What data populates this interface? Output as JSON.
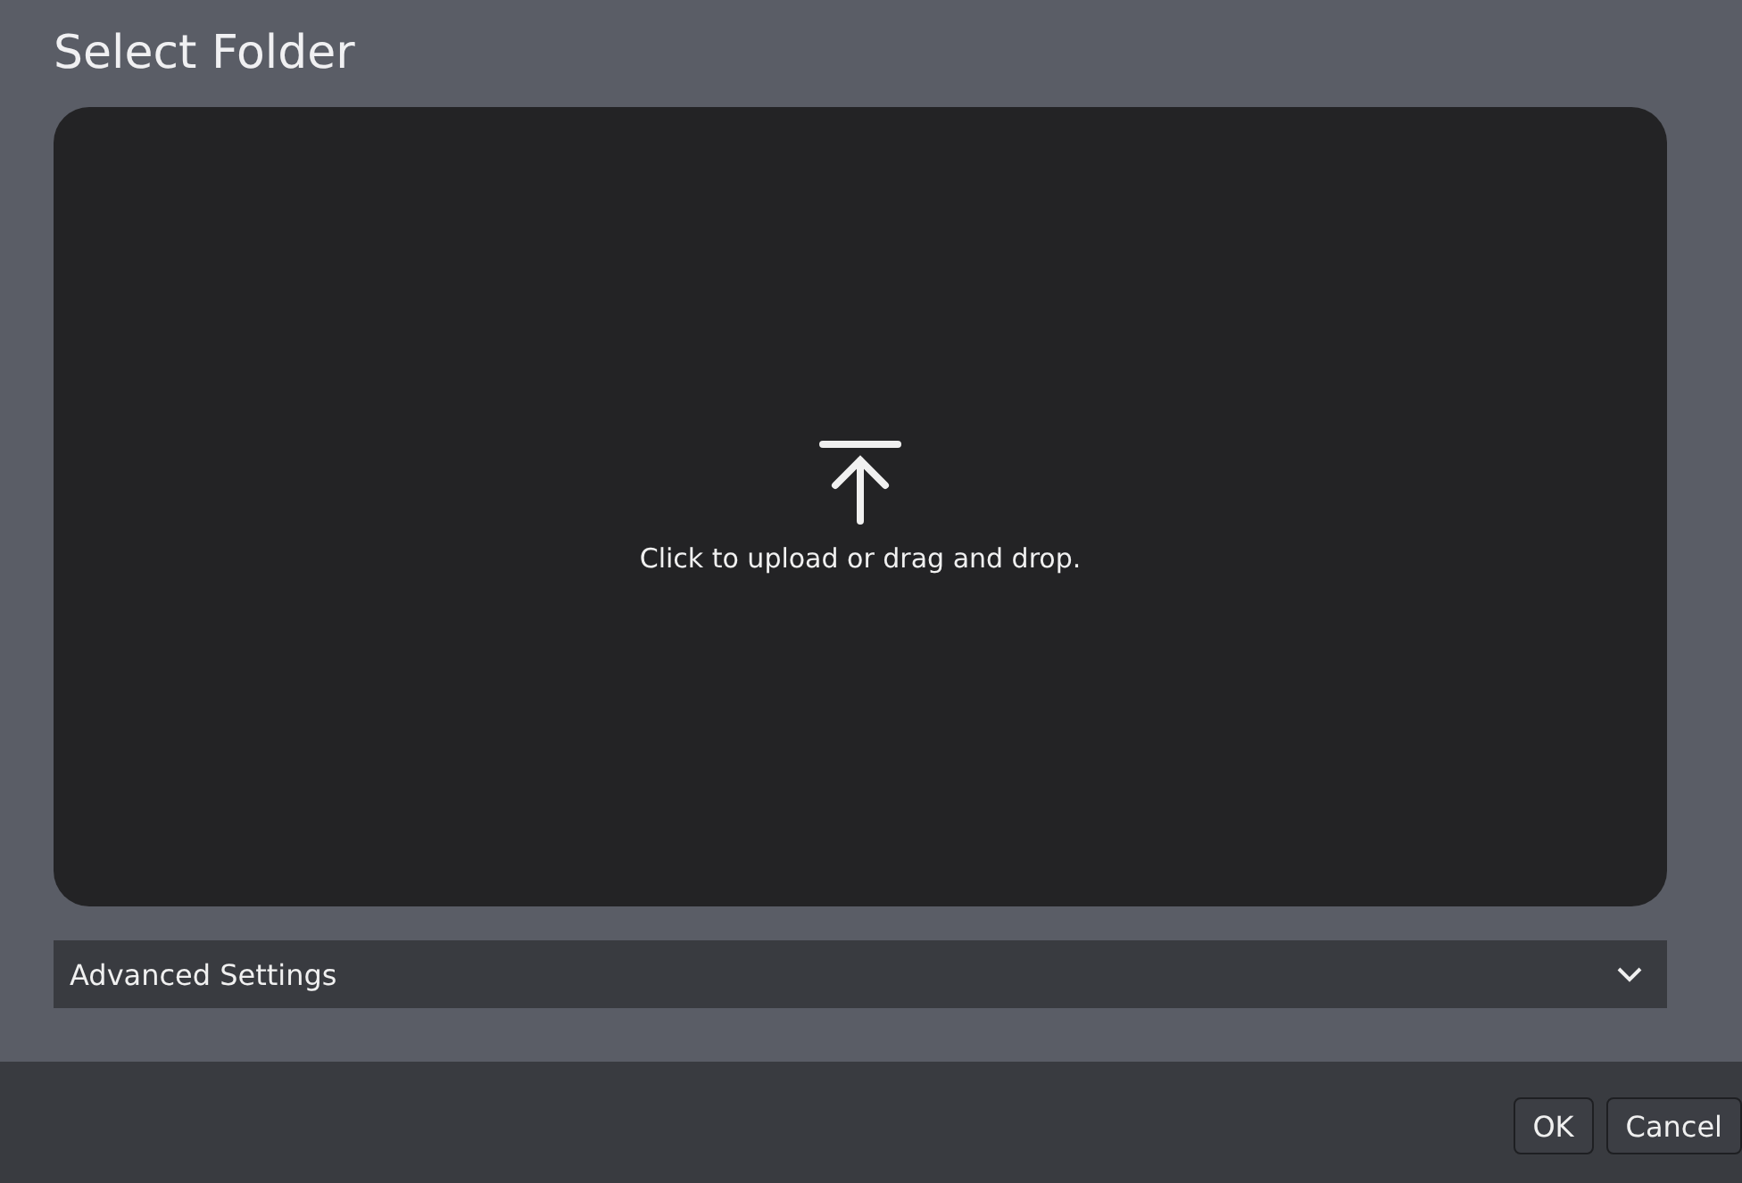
{
  "dialog": {
    "title": "Select Folder"
  },
  "dropzone": {
    "text": "Click to upload or drag and drop."
  },
  "advanced_settings": {
    "label": "Advanced Settings",
    "expanded": false
  },
  "buttons": [
    {
      "label": "OK"
    },
    {
      "label": "Cancel"
    }
  ]
}
